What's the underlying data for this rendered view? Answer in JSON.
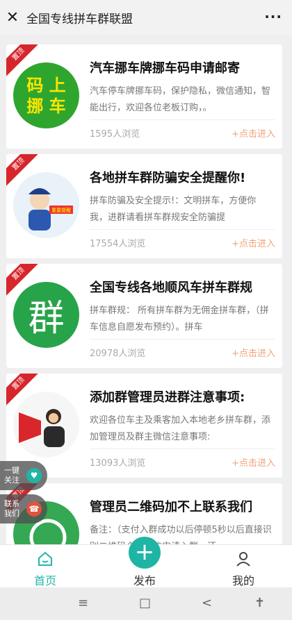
{
  "header": {
    "close_icon": "close-icon",
    "title": "全国专线拼车群联盟",
    "more_icon": "more-icon"
  },
  "badge_text": "置顶",
  "cards": [
    {
      "title": "汽车挪车牌挪车码申请邮寄",
      "desc": "汽车停车牌挪车码，保护隐私，微信通知，智能出行，欢迎各位老板订购，。",
      "views": "1595人浏览",
      "join": "+点击进入",
      "thumb_text": "码上挪车"
    },
    {
      "title": "各地拼车群防骗安全提醒你!",
      "desc": "拼车防骗及安全提示!：文明拼车，方便你我，进群请看拼车群规安全防骗提",
      "views": "17554人浏览",
      "join": "+点击进入",
      "thumb_text": "重要提醒"
    },
    {
      "title": "全国专线各地顺风车拼车群规",
      "desc": "拼车群规： 所有拼车群为无佣金拼车群，（拼车信息自愿发布预约）。拼车",
      "views": "20978人浏览",
      "join": "+点击进入",
      "thumb_text": "群"
    },
    {
      "title": "添加群管理员进群注意事项:",
      "desc": "欢迎各位车主及乘客加入本地老乡拼车群，添加管理员及群主微信注意事项:",
      "views": "13093人浏览",
      "join": "+点击进入",
      "thumb_text": ""
    },
    {
      "title": "管理员二维码加不上联系我们",
      "desc": "备注：（支付入群成功以后停顿5秒以后直接识别二维码个人微信申请入群，还",
      "views": "",
      "join": "",
      "thumb_text": ""
    }
  ],
  "float_buttons": [
    {
      "label": "一键关注",
      "icon": "heart-icon",
      "color": "#1fb5a5"
    },
    {
      "label": "联系我们",
      "icon": "phone-icon",
      "color": "#e0533f"
    }
  ],
  "tabs": [
    {
      "label": "首页",
      "icon": "home-icon",
      "active": true
    },
    {
      "label": "发布",
      "icon": "plus-icon",
      "active": false
    },
    {
      "label": "我的",
      "icon": "user-icon",
      "active": false
    }
  ],
  "system_nav": {
    "menu": "≡",
    "home": "□",
    "back": "<",
    "accessibility": "accessibility-icon"
  }
}
